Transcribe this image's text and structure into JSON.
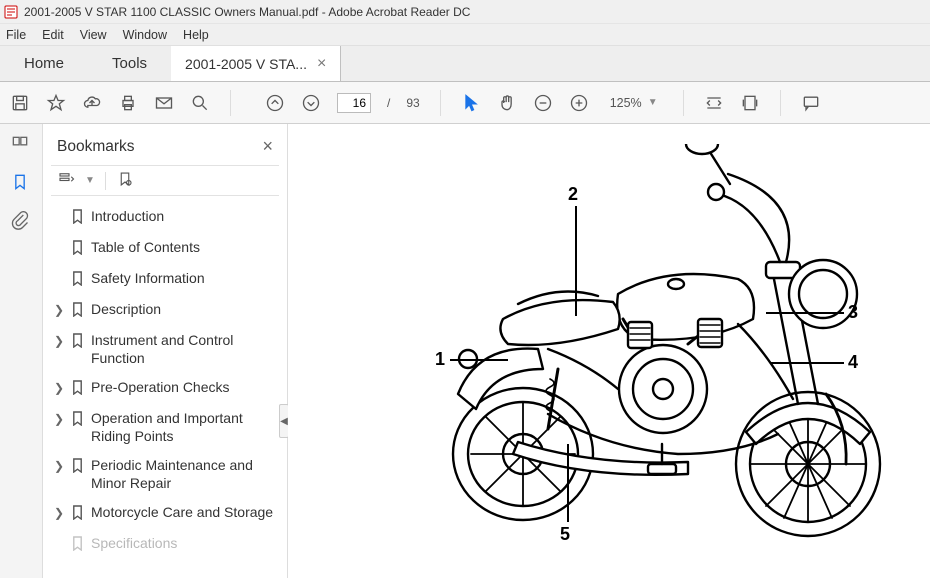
{
  "window": {
    "title": "2001-2005  V STAR 1100 CLASSIC Owners Manual.pdf - Adobe Acrobat Reader DC"
  },
  "menu": {
    "file": "File",
    "edit": "Edit",
    "view": "View",
    "window": "Window",
    "help": "Help"
  },
  "tabs": {
    "home": "Home",
    "tools": "Tools",
    "doc": "2001-2005  V STA..."
  },
  "nav": {
    "page": "16",
    "sep": "/",
    "total": "93",
    "zoom": "125%"
  },
  "sidebar": {
    "title": "Bookmarks",
    "items": [
      {
        "label": "Introduction",
        "expandable": false
      },
      {
        "label": "Table of Contents",
        "expandable": false
      },
      {
        "label": "Safety Information",
        "expandable": false
      },
      {
        "label": "Description",
        "expandable": true
      },
      {
        "label": "Instrument and Control Function",
        "expandable": true
      },
      {
        "label": "Pre-Operation Checks",
        "expandable": true
      },
      {
        "label": "Operation and Important Riding Points",
        "expandable": true
      },
      {
        "label": "Periodic Maintenance and Minor Repair",
        "expandable": true
      },
      {
        "label": "Motorcycle Care and Storage",
        "expandable": true
      },
      {
        "label": "Specifications",
        "expandable": false
      }
    ]
  },
  "callouts": {
    "c1": "1",
    "c2": "2",
    "c3": "3",
    "c4": "4",
    "c5": "5"
  }
}
